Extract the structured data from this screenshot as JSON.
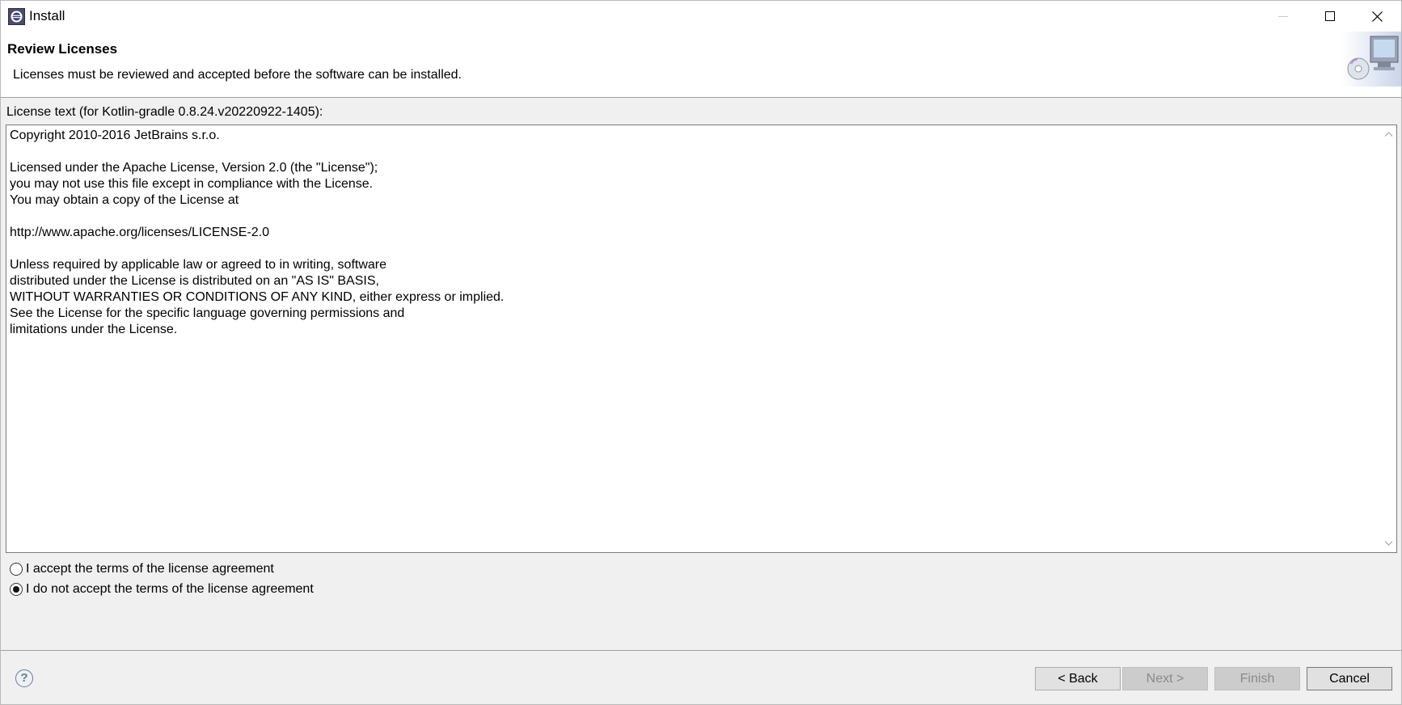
{
  "window": {
    "title": "Install",
    "controls": {
      "minimize": "minimize-icon",
      "maximize": "maximize-icon",
      "close": "close-icon"
    }
  },
  "header": {
    "title": "Review Licenses",
    "description": "Licenses must be reviewed and accepted before the software can be installed."
  },
  "license": {
    "label": "License text (for Kotlin-gradle 0.8.24.v20220922-1405):",
    "text": "Copyright 2010-2016 JetBrains s.r.o.\n\nLicensed under the Apache License, Version 2.0 (the \"License\");\nyou may not use this file except in compliance with the License.\nYou may obtain a copy of the License at\n\nhttp://www.apache.org/licenses/LICENSE-2.0\n\nUnless required by applicable law or agreed to in writing, software\ndistributed under the License is distributed on an \"AS IS\" BASIS,\nWITHOUT WARRANTIES OR CONDITIONS OF ANY KIND, either express or implied.\nSee the License for the specific language governing permissions and\nlimitations under the License."
  },
  "options": {
    "accept": {
      "label": "I accept the terms of the license agreement",
      "checked": false
    },
    "decline": {
      "label": "I do not accept the terms of the license agreement",
      "checked": true
    }
  },
  "footer": {
    "help": "?",
    "back": "< Back",
    "next": "Next >",
    "finish": "Finish",
    "cancel": "Cancel"
  }
}
